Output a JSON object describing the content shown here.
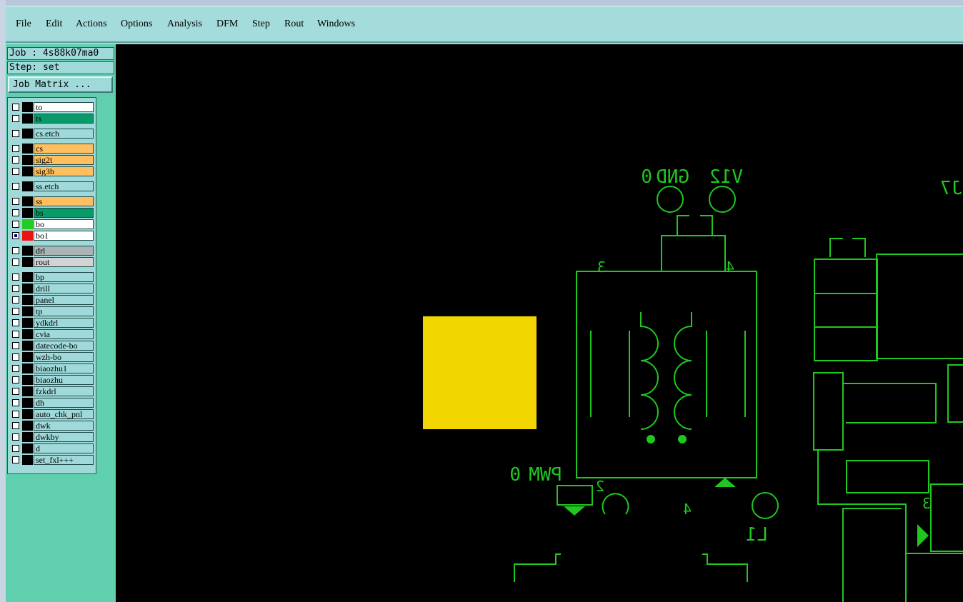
{
  "menu": [
    "File",
    "Edit",
    "Actions",
    "Options",
    "Analysis",
    "DFM",
    "Step",
    "Rout",
    "Windows"
  ],
  "job": {
    "label": "Job : 4s88k07ma0",
    "step": "Step: set",
    "matrix_button": "Job Matrix ..."
  },
  "layers": [
    {
      "name": "to",
      "bg": "#ffffff",
      "checked": false
    },
    {
      "name": "ts",
      "bg": "#0a9a6a",
      "checked": false
    },
    {
      "name": "cs.etch",
      "bg": "#9fd9d9",
      "checked": false
    },
    {
      "name": "cs",
      "bg": "#ffbf5e",
      "checked": false
    },
    {
      "name": "sig2t",
      "bg": "#ffbf5e",
      "checked": false
    },
    {
      "name": "sig3b",
      "bg": "#ffbf5e",
      "checked": false
    },
    {
      "name": "ss.etch",
      "bg": "#9fd9d9",
      "checked": false
    },
    {
      "name": "ss",
      "bg": "#ffbf5e",
      "checked": false
    },
    {
      "name": "bs",
      "bg": "#0a9a6a",
      "checked": false
    },
    {
      "name": "bo",
      "bg": "#ffffff",
      "checked": false,
      "swatch": "#22cc22"
    },
    {
      "name": "bo1",
      "bg": "#ffffff",
      "checked": true,
      "swatch": "#ee1111"
    },
    {
      "name": "drl",
      "bg": "#a9b5b5",
      "checked": false
    },
    {
      "name": "rout",
      "bg": "#d3d3d3",
      "checked": false
    },
    {
      "name": "bp",
      "bg": "#9fd9d9",
      "checked": false
    },
    {
      "name": "drill",
      "bg": "#9fd9d9",
      "checked": false
    },
    {
      "name": "panel",
      "bg": "#9fd9d9",
      "checked": false
    },
    {
      "name": "tp",
      "bg": "#9fd9d9",
      "checked": false
    },
    {
      "name": "ydkdrl",
      "bg": "#9fd9d9",
      "checked": false
    },
    {
      "name": "cvia",
      "bg": "#9fd9d9",
      "checked": false
    },
    {
      "name": "datecode-bo",
      "bg": "#9fd9d9",
      "checked": false
    },
    {
      "name": "wzh-bo",
      "bg": "#9fd9d9",
      "checked": false
    },
    {
      "name": "biaozhu1",
      "bg": "#9fd9d9",
      "checked": false
    },
    {
      "name": "biaozhu",
      "bg": "#9fd9d9",
      "checked": false
    },
    {
      "name": "fzkdrl",
      "bg": "#9fd9d9",
      "checked": false
    },
    {
      "name": "dh",
      "bg": "#9fd9d9",
      "checked": false
    },
    {
      "name": "auto_chk_pnl",
      "bg": "#9fd9d9",
      "checked": false
    },
    {
      "name": "dwk",
      "bg": "#9fd9d9",
      "checked": false
    },
    {
      "name": "dwkby",
      "bg": "#9fd9d9",
      "checked": false
    },
    {
      "name": "d",
      "bg": "#9fd9d9",
      "checked": false
    },
    {
      "name": "set_fxl+++",
      "bg": "#9fd9d9",
      "checked": false
    }
  ],
  "canvas": {
    "labels": {
      "gnd": "GND",
      "v12": "V12",
      "pwm": "PWM",
      "pin3": "3",
      "pin4": "4",
      "pin2": "2",
      "pin4b": "4",
      "l1": "L1",
      "j7": "J7",
      "pin3r": "3",
      "zero1": "0",
      "zero2": "0"
    },
    "colors": {
      "trace": "#1ec81e",
      "pad": "#f2d600",
      "background": "#000000"
    }
  }
}
